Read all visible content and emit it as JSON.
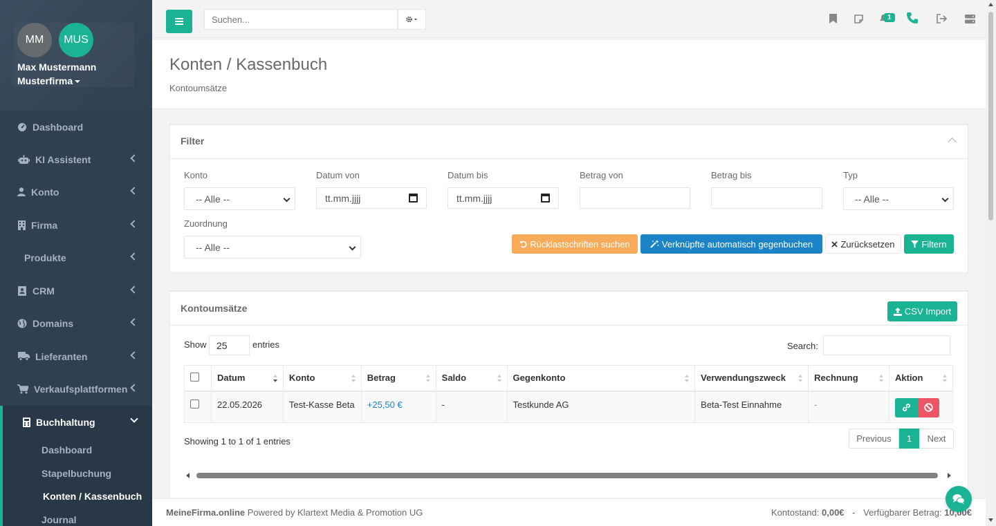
{
  "profile": {
    "initials_user": "MM",
    "initials_company": "MUS",
    "name": "Max Mustermann",
    "company": "Musterfirma"
  },
  "sidebar": {
    "items": [
      {
        "label": "Dashboard",
        "icon": "gauge-icon"
      },
      {
        "label": "KI Assistent",
        "icon": "robot-icon"
      },
      {
        "label": "Konto",
        "icon": "user-icon"
      },
      {
        "label": "Firma",
        "icon": "building-icon"
      },
      {
        "label": "Produkte",
        "icon": ""
      },
      {
        "label": "CRM",
        "icon": "address-book-icon"
      },
      {
        "label": "Domains",
        "icon": "globe-icon"
      },
      {
        "label": "Lieferanten",
        "icon": "truck-icon"
      },
      {
        "label": "Verkaufsplattformen",
        "icon": "cart-icon"
      },
      {
        "label": "Buchhaltung",
        "icon": "calculator-icon"
      }
    ],
    "subitems": [
      "Dashboard",
      "Stapelbuchung",
      "Konten / Kassenbuch",
      "Journal"
    ]
  },
  "topbar": {
    "search_placeholder": "Suchen...",
    "notification_count": "1"
  },
  "page": {
    "title": "Konten / Kassenbuch",
    "subtitle": "Kontoumsätze"
  },
  "filter": {
    "title": "Filter",
    "konto_label": "Konto",
    "konto_value": "-- Alle --",
    "datum_von_label": "Datum von",
    "datum_von_value": "tt.mm.jjjj",
    "datum_bis_label": "Datum bis",
    "datum_bis_value": "tt.mm.jjjj",
    "betrag_von_label": "Betrag von",
    "betrag_bis_label": "Betrag bis",
    "typ_label": "Typ",
    "typ_value": "-- Alle --",
    "zuordnung_label": "Zuordnung",
    "zuordnung_value": "-- Alle --",
    "btn_ruecklast": "Rücklastschriften suchen",
    "btn_verknuepft": "Verknüpfte automatisch gegenbuchen",
    "btn_reset": "Zurücksetzen",
    "btn_filter": "Filtern"
  },
  "table_box": {
    "title": "Kontoumsätze",
    "csv_import": "CSV Import",
    "show_label": "Show",
    "show_value": "25",
    "entries_label": "entries",
    "search_label": "Search:",
    "columns": [
      "Datum",
      "Konto",
      "Betrag",
      "Saldo",
      "Gegenkonto",
      "Verwendungszweck",
      "Rechnung",
      "Aktion"
    ],
    "rows": [
      {
        "datum": "22.05.2026",
        "konto": "Test-Kasse Beta",
        "betrag": "+25,50 €",
        "saldo": "-",
        "gegenkonto": "Testkunde AG",
        "verwendungszweck": "Beta-Test Einnahme",
        "rechnung": "-"
      }
    ],
    "info": "Showing 1 to 1 of 1 entries",
    "pager_prev": "Previous",
    "pager_page": "1",
    "pager_next": "Next"
  },
  "footer": {
    "brand": "MeineFirma.online",
    "powered": " Powered by Klartext Media & Promotion UG",
    "kontostand_label": "Kontostand:",
    "kontostand_value": "0,00€",
    "sep": "-",
    "verfuegbar_label": "Verfügbarer Betrag:",
    "verfuegbar_value": "10,00€"
  },
  "colors": {
    "sidebar": "#2f4050",
    "primary": "#1ab394",
    "blue": "#1c84c6",
    "warning": "#f8ac59",
    "danger": "#ed5565"
  }
}
